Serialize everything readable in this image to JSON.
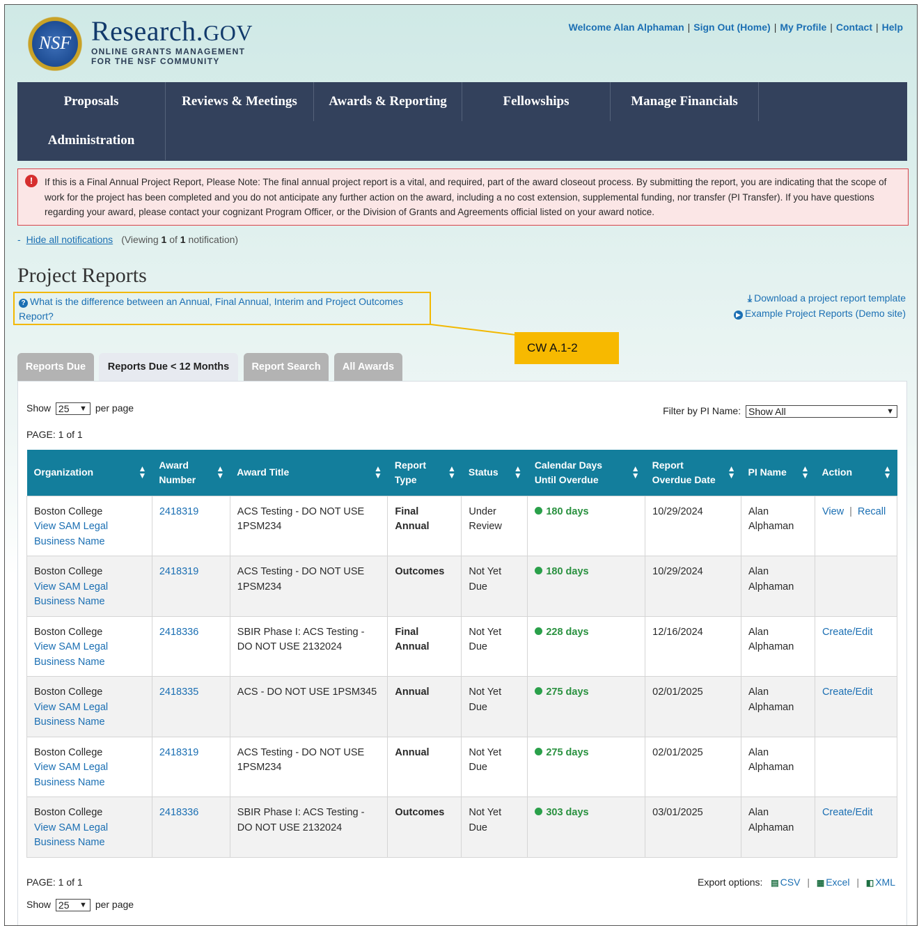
{
  "header": {
    "logo_seal_text": "NSF",
    "logo_title": "Research.",
    "logo_title_gov": "GOV",
    "logo_subtitle_line1": "ONLINE GRANTS MANAGEMENT",
    "logo_subtitle_line2": "FOR THE NSF COMMUNITY",
    "links": [
      "Welcome Alan Alphaman",
      "Sign Out (Home)",
      "My Profile",
      "Contact",
      "Help"
    ]
  },
  "nav": {
    "items": [
      "Proposals",
      "Reviews & Meetings",
      "Awards & Reporting",
      "Fellowships",
      "Manage Financials",
      "Administration"
    ]
  },
  "alert": {
    "icon": "exclamation-icon",
    "text": "If this is a Final Annual Project Report, Please Note: The final annual project report is a vital, and required, part of the award closeout process. By submitting the report, you are indicating that the scope of work for the project has been completed and you do not anticipate any further action on the award, including a no cost extension, supplemental funding, nor transfer (PI Transfer). If you have questions regarding your award, please contact your cognizant Program Officer, or the Division of Grants and Agreements official listed on your award notice."
  },
  "notifications": {
    "toggle_symbol": "-",
    "hide_label": "Hide all notifications",
    "viewing_prefix": "(Viewing ",
    "viewing_current": "1",
    "viewing_mid": " of ",
    "viewing_total": "1",
    "viewing_suffix": " notification)"
  },
  "page_title": "Project Reports",
  "help_link": "What is the difference between an Annual, Final Annual, Interim and Project Outcomes Report?",
  "callout": "CW A.1-2",
  "right_links": {
    "download": "Download a project report template",
    "examples": "Example Project Reports (Demo site)"
  },
  "tabs": [
    "Reports Due",
    "Reports Due < 12 Months",
    "Report Search",
    "All Awards"
  ],
  "active_tab": "Reports Due < 12 Months",
  "controls": {
    "show_label": "Show",
    "per_page_value": "25",
    "per_page_label": "per page",
    "filter_label": "Filter by PI Name:",
    "filter_value": "Show All",
    "page_label": "PAGE:",
    "page_value": "1 of 1"
  },
  "table": {
    "columns": [
      "Organization",
      "Award Number",
      "Award Title",
      "Report Type",
      "Status",
      "Calendar Days Until Overdue",
      "Report Overdue Date",
      "PI Name",
      "Action"
    ],
    "rows": [
      {
        "org": "Boston College",
        "sam_link": "View SAM Legal Business Name",
        "award": "2418319",
        "title": "ACS Testing - DO NOT USE 1PSM234",
        "type": "Final Annual",
        "status": "Under Review",
        "days": "180 days",
        "date": "10/29/2024",
        "pi": "Alan Alphaman",
        "actions": [
          "View",
          "Recall"
        ]
      },
      {
        "org": "Boston College",
        "sam_link": "View SAM Legal Business Name",
        "award": "2418319",
        "title": "ACS Testing - DO NOT USE 1PSM234",
        "type": "Outcomes",
        "status": "Not Yet Due",
        "days": "180 days",
        "date": "10/29/2024",
        "pi": "Alan Alphaman",
        "actions": []
      },
      {
        "org": "Boston College",
        "sam_link": "View SAM Legal Business Name",
        "award": "2418336",
        "title": "SBIR Phase I: ACS Testing - DO NOT USE 2132024",
        "type": "Final Annual",
        "status": "Not Yet Due",
        "days": "228 days",
        "date": "12/16/2024",
        "pi": "Alan Alphaman",
        "actions": [
          "Create/Edit"
        ]
      },
      {
        "org": "Boston College",
        "sam_link": "View SAM Legal Business Name",
        "award": "2418335",
        "title": "ACS - DO NOT USE 1PSM345",
        "type": "Annual",
        "status": "Not Yet Due",
        "days": "275 days",
        "date": "02/01/2025",
        "pi": "Alan Alphaman",
        "actions": [
          "Create/Edit"
        ]
      },
      {
        "org": "Boston College",
        "sam_link": "View SAM Legal Business Name",
        "award": "2418319",
        "title": "ACS Testing - DO NOT USE 1PSM234",
        "type": "Annual",
        "status": "Not Yet Due",
        "days": "275 days",
        "date": "02/01/2025",
        "pi": "Alan Alphaman",
        "actions": []
      },
      {
        "org": "Boston College",
        "sam_link": "View SAM Legal Business Name",
        "award": "2418336",
        "title": "SBIR Phase I: ACS Testing - DO NOT USE 2132024",
        "type": "Outcomes",
        "status": "Not Yet Due",
        "days": "303 days",
        "date": "03/01/2025",
        "pi": "Alan Alphaman",
        "actions": [
          "Create/Edit"
        ]
      }
    ]
  },
  "export": {
    "label": "Export options:",
    "options": [
      "CSV",
      "Excel",
      "XML"
    ]
  },
  "colors": {
    "nav_bg": "#33415c",
    "table_header": "#137e9c",
    "link": "#1b6fb3",
    "status_green": "#2aa04a",
    "callout": "#f7b900",
    "alert_border": "#d8434a"
  }
}
